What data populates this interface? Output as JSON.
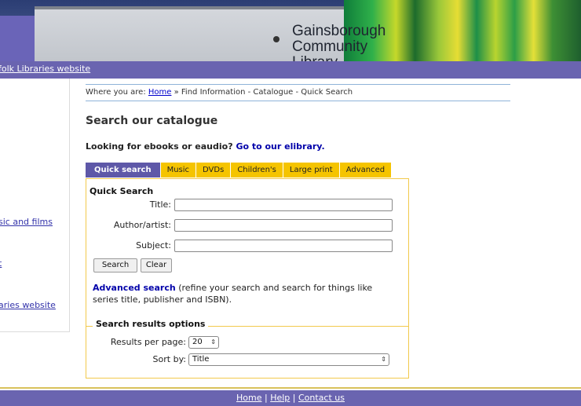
{
  "banner": {
    "sign_line1": "Gainsborough",
    "sign_line2": "Community",
    "sign_line3": "Library"
  },
  "topbar": {
    "link": "folk Libraries website"
  },
  "leftnav": {
    "items": [
      {
        "label": "sic and films"
      },
      {
        "label": "t"
      },
      {
        "label": "aries website"
      }
    ]
  },
  "breadcrumb": {
    "prefix": "Where you are:",
    "home": "Home",
    "rest": "» Find Information - Catalogue - Quick Search"
  },
  "page": {
    "title": "Search our catalogue",
    "ebook_text": "Looking for ebooks or eaudio?",
    "ebook_link": "Go to our elibrary."
  },
  "tabs": [
    {
      "label": "Quick search"
    },
    {
      "label": "Music"
    },
    {
      "label": "DVDs"
    },
    {
      "label": "Children's"
    },
    {
      "label": "Large print"
    },
    {
      "label": "Advanced"
    }
  ],
  "quick": {
    "heading": "Quick Search",
    "title_label": "Title:",
    "author_label": "Author/artist:",
    "subject_label": "Subject:",
    "title_value": "",
    "author_value": "",
    "subject_value": "",
    "search_button": "Search",
    "clear_button": "Clear",
    "advanced_link": "Advanced search",
    "advanced_text": "(refine your search and search for things like series title, publisher and ISBN)."
  },
  "results": {
    "heading": "Search results options",
    "per_page_label": "Results per page:",
    "per_page_value": "20",
    "sort_label": "Sort by:",
    "sort_value": "Title"
  },
  "footer": {
    "home": "Home",
    "help": "Help",
    "contact": "Contact us",
    "separator": "|"
  },
  "colors": {
    "nav_purple": "#6a64b0",
    "tab_active": "#5e58a8",
    "tab_yellow": "#f5c400",
    "panel_border": "#f2c94c"
  }
}
